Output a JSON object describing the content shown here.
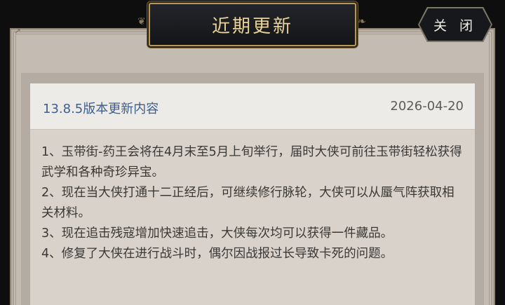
{
  "window": {
    "title": "近期更新",
    "close_label": "关 闭"
  },
  "update": {
    "version_title": "13.8.5版本更新内容",
    "date": "2026-04-20",
    "notes": [
      "1、玉带街-药王会将在4月末至5月上旬举行，届时大侠可前往玉带街轻松获得武学和各种奇珍异宝。",
      "2、现在当大侠打通十二正经后，可继续修行脉轮，大侠可以从蜃气阵获取相关材料。",
      "3、现在追击残寇增加快速追击，大侠每次均可以获得一件藏品。",
      "4、修复了大侠在进行战斗时，偶尔因战报过长导致卡死的问题。"
    ]
  },
  "colors": {
    "title_gold": "#e8d39a",
    "version_blue": "#3e5e8c",
    "panel_bg": "#c4bcb3"
  }
}
